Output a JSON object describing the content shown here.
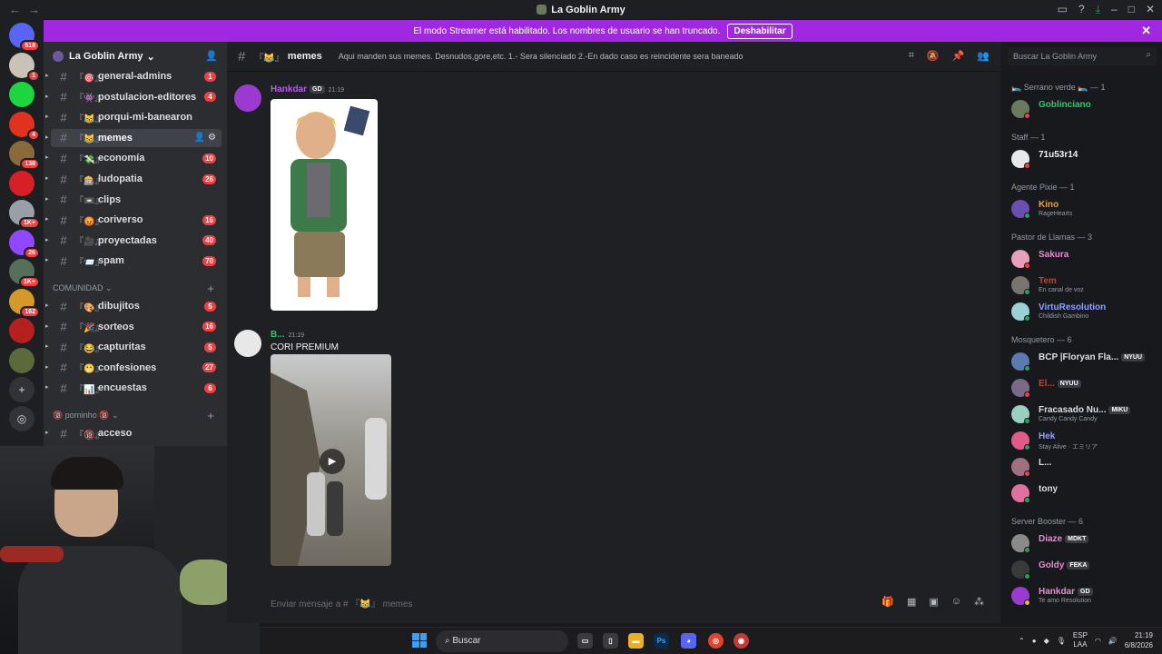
{
  "window": {
    "title": "La Goblin Army"
  },
  "banner": {
    "text": "El modo Streamer está habilitado. Los nombres de usuario se han truncado.",
    "button": "Deshabilitar"
  },
  "servers": [
    {
      "badge": "518",
      "color": "#5865f2"
    },
    {
      "badge": "1",
      "color": "#c9c2b6"
    },
    {
      "badge": "",
      "color": "#1dd63f"
    },
    {
      "badge": "4",
      "color": "#e0321f"
    },
    {
      "badge": "138",
      "color": "#8a6a3a"
    },
    {
      "badge": "",
      "color": "#d91f26"
    },
    {
      "badge": "1K+",
      "color": "#9a9ea6"
    },
    {
      "badge": "26",
      "color": "#9146ff"
    },
    {
      "badge": "1K+",
      "color": "#55705a"
    },
    {
      "badge": "162",
      "color": "#d39a2a"
    },
    {
      "badge": "",
      "color": "#b81f1f"
    },
    {
      "badge": "",
      "color": "#5a6a3a"
    }
  ],
  "guild": {
    "name": "La Goblin Army"
  },
  "channels": [
    {
      "emoji": "『🎯』",
      "name": "general-admins",
      "count": "1"
    },
    {
      "emoji": "『👾』",
      "name": "postulacion-editores",
      "count": "4"
    },
    {
      "emoji": "『😹』",
      "name": "porqui-mi-banearon",
      "count": ""
    },
    {
      "emoji": "『😹』",
      "name": "memes",
      "count": "",
      "selected": true
    },
    {
      "emoji": "『💸』",
      "name": "economía",
      "count": "10"
    },
    {
      "emoji": "『🎰』",
      "name": "ludopatia",
      "count": "26"
    },
    {
      "emoji": "『📼』",
      "name": "clips",
      "count": ""
    },
    {
      "emoji": "『😡』",
      "name": "coriverso",
      "count": "16"
    },
    {
      "emoji": "『🎥』",
      "name": "proyectadas",
      "count": "40"
    },
    {
      "emoji": "『📨』",
      "name": "spam",
      "count": "70"
    }
  ],
  "category": "COMUNIDAD",
  "community_channels": [
    {
      "emoji": "『🎨』",
      "name": "dibujitos",
      "count": "5"
    },
    {
      "emoji": "『🎉』",
      "name": "sorteos",
      "count": "16"
    },
    {
      "emoji": "『😂』",
      "name": "capturitas",
      "count": "5"
    },
    {
      "emoji": "『😬』",
      "name": "confesiones",
      "count": "27"
    },
    {
      "emoji": "『📊』",
      "name": "encuestas",
      "count": "6"
    }
  ],
  "category2": "🔞 porninho 🔞",
  "private_channels": [
    {
      "emoji": "『🔞』",
      "name": "acceso",
      "count": ""
    }
  ],
  "chat": {
    "channel_emoji": "『😹』",
    "channel_name": "memes",
    "topic": "Aqui manden sus memes. Desnudos,gore,etc. 1.- Sera silenciado 2.-En dado caso es reincidente sera baneado",
    "composer_placeholder": "Enviar mensaje a # 『😹』 memes"
  },
  "messages": [
    {
      "author": "Hankdar",
      "tag": "GD",
      "time": "21:19",
      "text": "",
      "color": "#b85cf0"
    },
    {
      "author": "B...",
      "tag": "",
      "time": "21:19",
      "text": "CORI PREMIUM",
      "color": "#2dc770"
    }
  ],
  "search_placeholder": "Buscar La Goblin Army",
  "member_groups": [
    {
      "label": "🛌 Serrano verde 🛌 — 1",
      "members": [
        {
          "name": "Goblinciano",
          "sub": "",
          "badge": "",
          "color": "#2dc770",
          "status": "#f23f42",
          "av": "#6a7a5a"
        }
      ]
    },
    {
      "label": "Staff — 1",
      "members": [
        {
          "name": "71u53r14",
          "sub": "",
          "badge": "",
          "color": "#f2f3f5",
          "status": "#f23f42",
          "av": "#e8e8e8"
        }
      ]
    },
    {
      "label": "Agente Pixie — 1",
      "members": [
        {
          "name": "Kino",
          "sub": "RageHearts",
          "badge": "",
          "color": "#f0a232",
          "status": "#23a55a",
          "av": "#6b4fb0"
        }
      ]
    },
    {
      "label": "Pastor de Llamas — 3",
      "members": [
        {
          "name": "Sakura",
          "sub": "",
          "badge": "",
          "color": "#e88ad6",
          "status": "#f23f42",
          "av": "#e8a0b8"
        },
        {
          "name": "Tem",
          "sub": "En canal de voz",
          "badge": "",
          "color": "#c2412d",
          "status": "#23a55a",
          "av": "#7a7470"
        },
        {
          "name": "VirtuResolution",
          "sub": "Childish Gambino",
          "badge": "",
          "color": "#8fa0ff",
          "status": "#23a55a",
          "av": "#9ad0d6"
        }
      ]
    },
    {
      "label": "Mosquetero — 6",
      "members": [
        {
          "name": "BCP |Floryan Fla...",
          "sub": "",
          "badge": "NYUU",
          "color": "#dbdee1",
          "status": "#23a55a",
          "av": "#5a7ab0"
        },
        {
          "name": "El...",
          "sub": "",
          "badge": "NYUU",
          "color": "#c2412d",
          "status": "#f23f42",
          "av": "#7a6a8a"
        },
        {
          "name": "Fracasado Nu...",
          "sub": "Candy Candy Candy",
          "badge": "MIKU",
          "color": "#dbdee1",
          "status": "#23a55a",
          "av": "#9ad0c0"
        },
        {
          "name": "Hek",
          "sub": "Stay Alive · エミリア",
          "badge": "",
          "color": "#8fa0ff",
          "status": "#23a55a",
          "av": "#e05a8a"
        },
        {
          "name": "L...",
          "sub": "",
          "badge": "",
          "color": "#dbdee1",
          "status": "#f23f42",
          "av": "#a07080"
        },
        {
          "name": "tony",
          "sub": "",
          "badge": "",
          "color": "#dbdee1",
          "status": "#23a55a",
          "av": "#e070a0"
        }
      ]
    },
    {
      "label": "Server Booster — 6",
      "members": [
        {
          "name": "Diaze",
          "sub": "",
          "badge": "MDKT",
          "color": "#e88ad6",
          "status": "#23a55a",
          "av": "#8a8a8a"
        },
        {
          "name": "Goldy",
          "sub": "",
          "badge": "FEKA",
          "color": "#e88ad6",
          "status": "#23a55a",
          "av": "#3a3a3a"
        },
        {
          "name": "Hankdar",
          "sub": "Te amo Resolution",
          "badge": "GD",
          "color": "#e88ad6",
          "status": "#f0b232",
          "av": "#9a3ad0"
        }
      ]
    }
  ],
  "taskbar": {
    "search": "Buscar",
    "lang1": "ESP",
    "lang2": "LAA",
    "time": "21:19",
    "date": "6/8/2026"
  }
}
